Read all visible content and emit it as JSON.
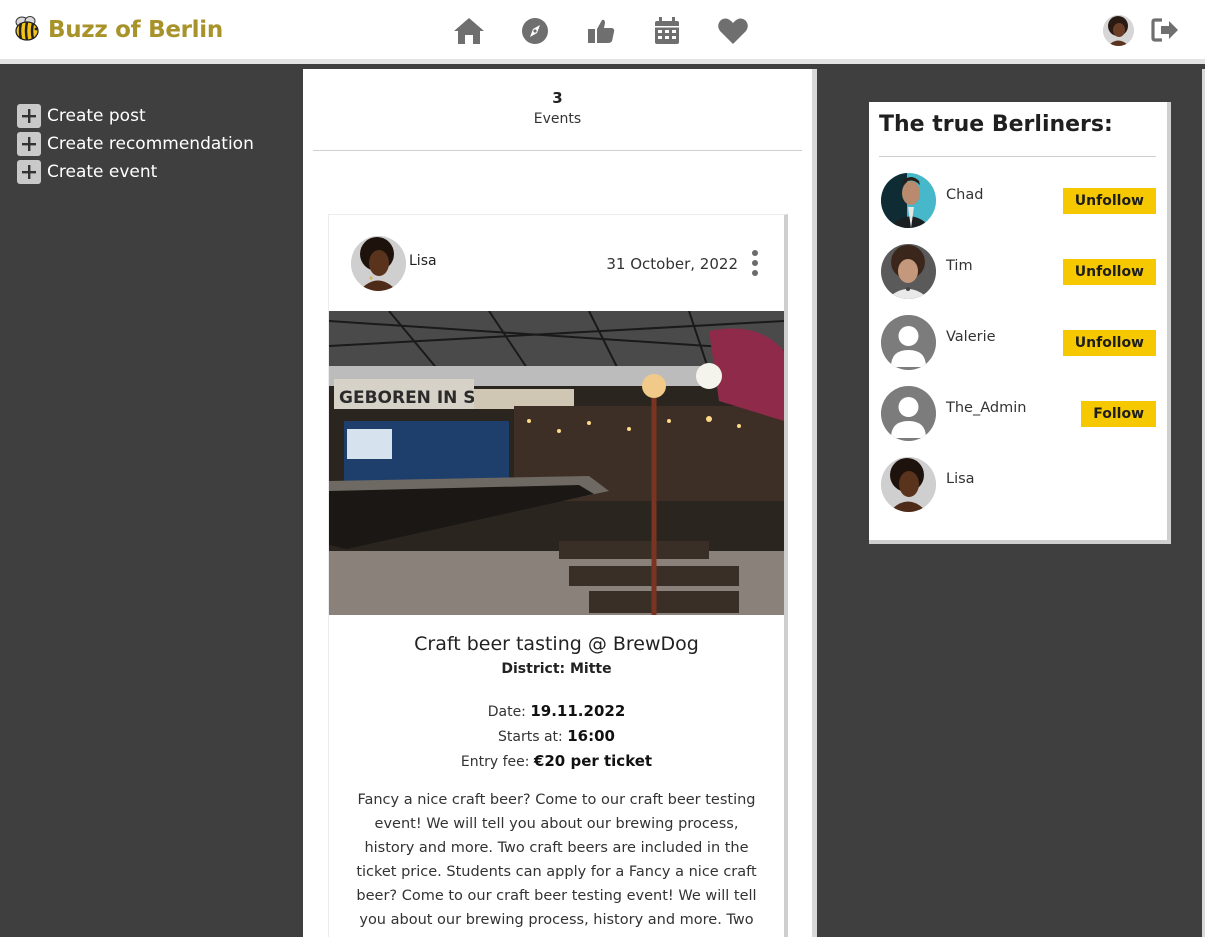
{
  "app": {
    "brand": "Buzz of Berlin"
  },
  "nav": {
    "items": [
      {
        "icon": "home-icon"
      },
      {
        "icon": "compass-icon"
      },
      {
        "icon": "thumbs-up-icon"
      },
      {
        "icon": "calendar-icon"
      },
      {
        "icon": "heart-icon"
      }
    ],
    "icon_color": "#6f6f6f",
    "logout_icon": "sign-out-icon"
  },
  "sidebar": {
    "create_items": [
      {
        "label": "Create post"
      },
      {
        "label": "Create recommendation"
      },
      {
        "label": "Create event"
      }
    ]
  },
  "stats": {
    "count": "3",
    "label": "Events"
  },
  "post": {
    "author": "Lisa",
    "date": "31 October, 2022",
    "title": "Craft beer tasting @ BrewDog",
    "district_label": "District:",
    "district": "Mitte",
    "date_label": "Date:",
    "event_date": "19.11.2022",
    "starts_label": "Starts at:",
    "starts": "16:00",
    "fee_label": "Entry fee:",
    "fee": "€20 per ticket",
    "description": "Fancy a nice craft beer? Come to our craft beer testing event! We will tell you about our brewing process, history and more. Two craft beers are included in the ticket price. Students can apply for a Fancy a nice craft beer? Come to our craft beer testing event! We will tell you about our brewing process, history and more. Two craft beers are",
    "image_banner": "GEBOREN IN SCHOTT"
  },
  "berliners": {
    "title": "The true Berliners:",
    "users": [
      {
        "name": "Chad",
        "action": "Unfollow"
      },
      {
        "name": "Tim",
        "action": "Unfollow"
      },
      {
        "name": "Valerie",
        "action": "Unfollow"
      },
      {
        "name": "The_Admin",
        "action": "Follow"
      },
      {
        "name": "Lisa",
        "action": ""
      }
    ]
  },
  "colors": {
    "brand": "#a8932a",
    "accent": "#f5c800",
    "dark_bg": "#3f3f3f"
  }
}
